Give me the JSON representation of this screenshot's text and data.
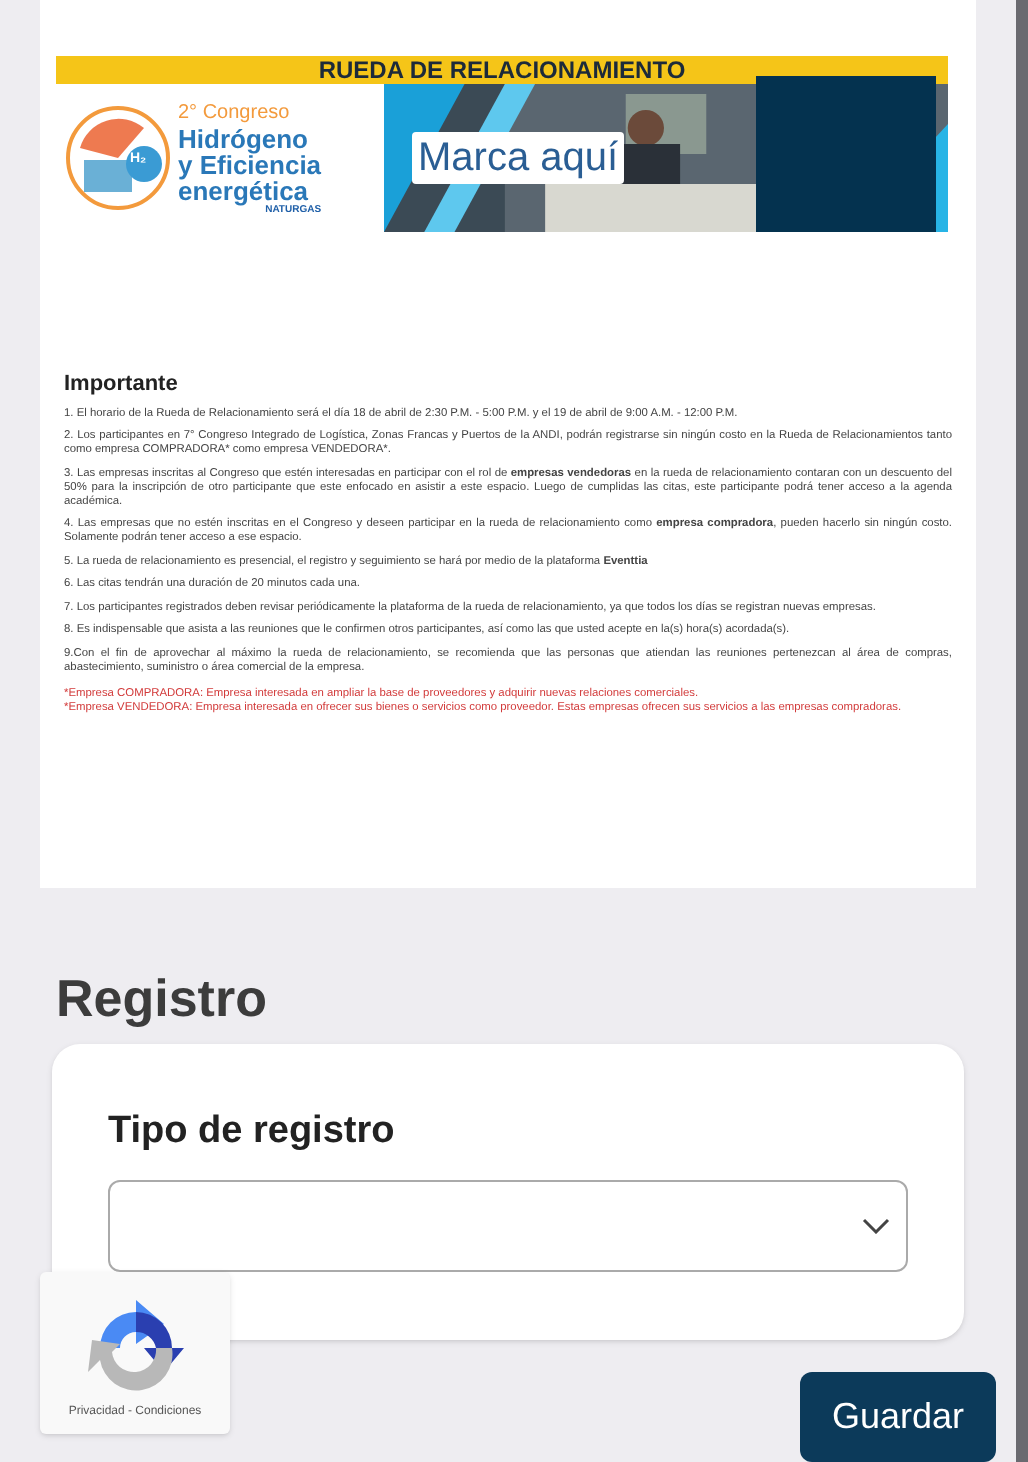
{
  "banner": {
    "title": "RUEDA DE RELACIONAMIENTO",
    "edition": "2° Congreso",
    "name_lines": [
      "Hidrógeno",
      "y Eficiencia",
      "energética"
    ],
    "sponsor": "NATURGAS",
    "badge": "H₂",
    "cta": "Marca aquí"
  },
  "important": {
    "heading": "Importante",
    "items": [
      "1. El horario de la Rueda de Relacionamiento será el día 18 de abril de 2:30 P.M. - 5:00 P.M. y el 19 de abril de 9:00 A.M. - 12:00 P.M.",
      "2. Los participantes en 7° Congreso Integrado de Logística, Zonas Francas y Puertos de la ANDI, podrán registrarse sin ningún costo en la Rueda de Relacionamientos tanto como empresa COMPRADORA* como empresa VENDEDORA*.",
      "3. Las empresas inscritas al Congreso que estén interesadas en participar con el rol de **empresas vendedoras** en la rueda de relacionamiento contaran con un descuento del 50% para la inscripción de otro participante que este enfocado en asistir a este espacio. Luego de cumplidas las citas, este participante podrá tener acceso a la agenda académica.",
      "4. Las empresas que no estén inscritas en el Congreso y deseen participar en la rueda de relacionamiento como **empresa compradora**, pueden hacerlo sin ningún costo. Solamente podrán tener acceso a ese espacio.",
      "5. La rueda de relacionamiento es presencial, el registro y seguimiento se hará por medio de la plataforma **Eventtia**",
      "6. Las citas tendrán una duración de 20 minutos cada una.",
      "7. Los participantes registrados deben revisar periódicamente la plataforma de la rueda de relacionamiento, ya que todos los días se registran nuevas empresas.",
      "8. Es indispensable que asista a las reuniones que le confirmen otros participantes, así como las que usted acepte en la(s) hora(s) acordada(s).",
      "9.Con el fin de aprovechar al máximo la rueda de relacionamiento, se recomienda que las personas que atiendan las reuniones pertenezcan al área de compras, abastecimiento, suministro o área comercial de la empresa."
    ],
    "notes": [
      "*Empresa COMPRADORA: Empresa interesada en ampliar la base de proveedores y adquirir nuevas relaciones comerciales.",
      "*Empresa VENDEDORA: Empresa interesada en ofrecer sus bienes o servicios como proveedor. Estas empresas ofrecen sus servicios a las empresas compradoras."
    ]
  },
  "registro": {
    "heading": "Registro",
    "field_label": "Tipo de registro",
    "button": "Guardar"
  },
  "recaptcha": {
    "links": "Privacidad - Condiciones"
  }
}
